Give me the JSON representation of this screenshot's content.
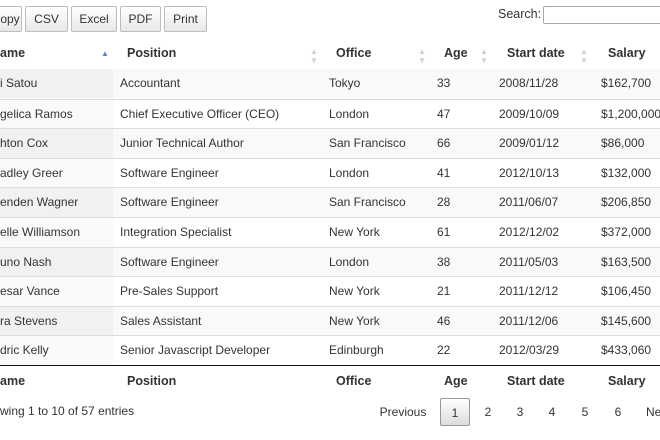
{
  "toolbar": {
    "buttons": [
      {
        "name": "copy-button",
        "label": "opy"
      },
      {
        "name": "csv-button",
        "label": "CSV"
      },
      {
        "name": "excel-button",
        "label": "Excel"
      },
      {
        "name": "pdf-button",
        "label": "PDF"
      },
      {
        "name": "print-button",
        "label": "Print"
      }
    ],
    "search_label": "Search:",
    "search_value": ""
  },
  "table": {
    "headers": [
      "ame",
      "Position",
      "Office",
      "Age",
      "Start date",
      "Salary"
    ],
    "sorted_column": 0,
    "sort_direction": "ascending",
    "rows": [
      [
        "i Satou",
        "Accountant",
        "Tokyo",
        "33",
        "2008/11/28",
        "$162,700"
      ],
      [
        "gelica Ramos",
        "Chief Executive Officer (CEO)",
        "London",
        "47",
        "2009/10/09",
        "$1,200,000"
      ],
      [
        "hton Cox",
        "Junior Technical Author",
        "San Francisco",
        "66",
        "2009/01/12",
        "$86,000"
      ],
      [
        "adley Greer",
        "Software Engineer",
        "London",
        "41",
        "2012/10/13",
        "$132,000"
      ],
      [
        "enden Wagner",
        "Software Engineer",
        "San Francisco",
        "28",
        "2011/06/07",
        "$206,850"
      ],
      [
        "elle Williamson",
        "Integration Specialist",
        "New York",
        "61",
        "2012/12/02",
        "$372,000"
      ],
      [
        "uno Nash",
        "Software Engineer",
        "London",
        "38",
        "2011/05/03",
        "$163,500"
      ],
      [
        "esar Vance",
        "Pre-Sales Support",
        "New York",
        "21",
        "2011/12/12",
        "$106,450"
      ],
      [
        "ra Stevens",
        "Sales Assistant",
        "New York",
        "46",
        "2011/12/06",
        "$145,600"
      ],
      [
        "dric Kelly",
        "Senior Javascript Developer",
        "Edinburgh",
        "22",
        "2012/03/29",
        "$433,060"
      ]
    ],
    "footers": [
      "ame",
      "Position",
      "Office",
      "Age",
      "Start date",
      "Salary"
    ]
  },
  "info": "wing 1 to 10 of 57 entries",
  "pagination": {
    "previous": "Previous",
    "pages": [
      "1",
      "2",
      "3",
      "4",
      "5",
      "6"
    ],
    "current": "1",
    "next": "Ne"
  },
  "colors": {
    "sort_active": "#5b7fc8",
    "sort_inactive": "#cfcfcf",
    "sorted_column_bg": "#f1f1f1"
  }
}
